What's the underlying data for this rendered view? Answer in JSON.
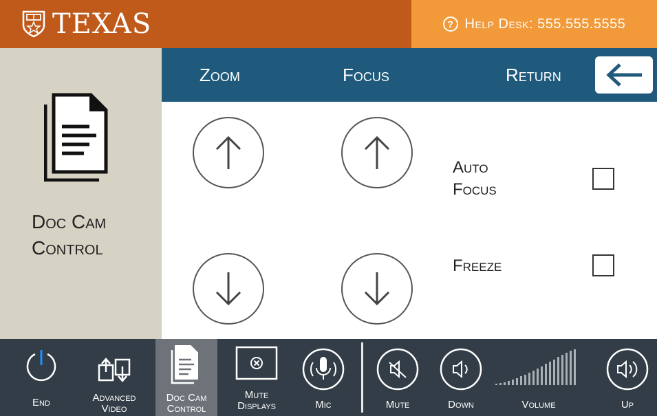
{
  "header": {
    "logo_text": "TEXAS",
    "help_desk": "Help Desk: 555.555.5555"
  },
  "left_panel": {
    "icon": "document-icon",
    "title_line1": "Doc Cam",
    "title_line2": "Control"
  },
  "nav": {
    "zoom_label": "Zoom",
    "focus_label": "Focus",
    "return_label": "Return",
    "back_icon": "arrow-left-icon"
  },
  "controls": {
    "auto_focus_line1": "Auto",
    "auto_focus_line2": "Focus",
    "auto_focus_checked": false,
    "freeze_label": "Freeze",
    "freeze_checked": false
  },
  "bottom_bar": {
    "end": "End",
    "advanced_video": "Advanced\nVideo",
    "doc_cam_control": "Doc Cam\nControl",
    "mute_displays": "Mute\nDisplays",
    "mic": "Mic",
    "mute": "Mute",
    "down": "Down",
    "volume": "Volume",
    "up": "Up",
    "active_item": "Doc Cam Control",
    "volume_level_bars_lit": 0
  },
  "colors": {
    "burnt_orange": "#bf5a1b",
    "help_orange": "#f29a3a",
    "nav_blue": "#1f5a7c",
    "panel_beige": "#d6d2c4",
    "bottom_dark": "#323d47",
    "active_gray": "#6d7378",
    "power_blue": "#1e90ff"
  }
}
